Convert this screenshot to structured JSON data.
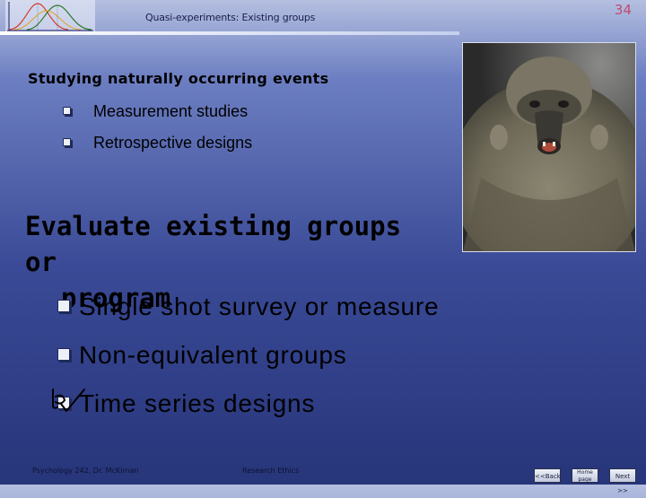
{
  "header": {
    "title": "Quasi-experiments: Existing groups",
    "slide_number": "34"
  },
  "section_1": {
    "heading": "Studying naturally occurring events",
    "items": [
      "Measurement studies",
      "Retrospective designs"
    ]
  },
  "section_2": {
    "heading_line1": "Evaluate existing groups or",
    "heading_line2": "program",
    "items": [
      "Single shot survey or measure",
      "Non-equivalent groups",
      "Time series designs"
    ]
  },
  "footer": {
    "course": "Psychology 242, Dr. McKirnan",
    "topic": "Research Ethics",
    "back": "<<Back",
    "home": "Home page",
    "next": "Next >>"
  },
  "colors": {
    "background_top": "#b4bfe0",
    "background_bottom": "#27357a",
    "slide_number": "#c24a6e"
  },
  "icons": {
    "bullet": "checkbox-bullet-icon",
    "tick": "checkmark-icon",
    "header": "distribution-curves-icon"
  }
}
